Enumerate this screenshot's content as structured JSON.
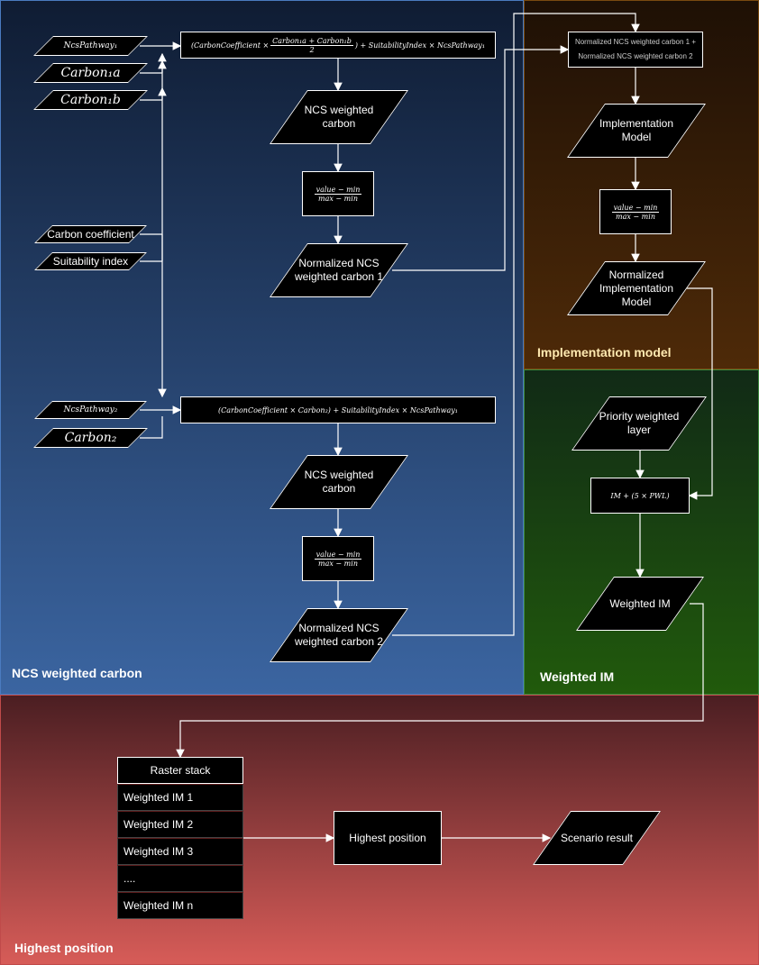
{
  "regions": {
    "ncs": "NCS weighted carbon",
    "implementation": "Implementation model",
    "weighted_im": "Weighted IM",
    "highest": "Highest position"
  },
  "inputs": {
    "ncs_pathway_1": "NcsPathway₁",
    "carbon_1a": "Carbon₁a",
    "carbon_1b": "Carbon₁b",
    "carbon_coefficient": "Carbon coefficient",
    "suitability_index": "Suitability index",
    "ncs_pathway_2": "NcsPathway₂",
    "carbon_2": "Carbon₂"
  },
  "formula1": {
    "pre": "(CarbonCoefficient ×",
    "num": "Carbon₁a + Carbon₁b",
    "den": "2",
    "post": ") + SuitabilityIndex × NcsPathway₁"
  },
  "formula2": "(CarbonCoefficient × Carbon₂) + SuitabilityIndex × NcsPathway₁",
  "normalize": {
    "num": "value − min",
    "den": "max − min"
  },
  "nodes": {
    "ncs_weighted_carbon": "NCS weighted carbon",
    "normalized_1": "Normalized NCS weighted carbon 1",
    "normalized_2": "Normalized NCS weighted carbon 2",
    "sum_line1": "Normalized NCS weighted carbon 1 +",
    "sum_line2": "Normalized NCS weighted carbon 2",
    "implementation_model": "Implementation Model",
    "normalized_im": "Normalized Implementation Model",
    "priority_layer": "Priority weighted layer",
    "im_formula": "IM + (5 × PWL)",
    "weighted_im": "Weighted IM",
    "highest_position": "Highest position",
    "scenario_result": "Scenario result"
  },
  "raster_stack": {
    "title": "Raster stack",
    "rows": [
      "Weighted IM 1",
      "Weighted IM 2",
      "Weighted IM 3",
      "....",
      "Weighted IM n"
    ]
  }
}
